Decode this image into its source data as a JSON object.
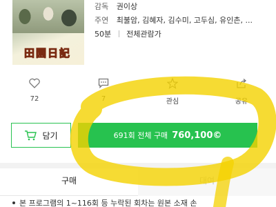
{
  "info": {
    "director_label": "감독",
    "director": "권이상",
    "cast_label": "주연",
    "cast": "최불암, 김혜자, 김수미, 고두심, 유인촌, ...",
    "runtime": "50분",
    "rating": "전체관람가"
  },
  "poster": {
    "title_text": "田園日記"
  },
  "actions": [
    {
      "icon": "heart-icon",
      "label": "72"
    },
    {
      "icon": "comment-icon",
      "label": "7"
    },
    {
      "icon": "star-icon",
      "label": "관심"
    },
    {
      "icon": "share-icon",
      "label": "공유"
    }
  ],
  "purchase": {
    "cart_label": "담기",
    "buy_text": "691회 전체 구매",
    "price": "760,100©"
  },
  "tabs": [
    {
      "label": "구매"
    },
    {
      "label": "대여"
    }
  ],
  "notice": "본 프로그램의 1~116회 등 누락된 회차는 원본 소재 손",
  "colors": {
    "accent": "#27c24f",
    "highlight": "#f4d200"
  }
}
